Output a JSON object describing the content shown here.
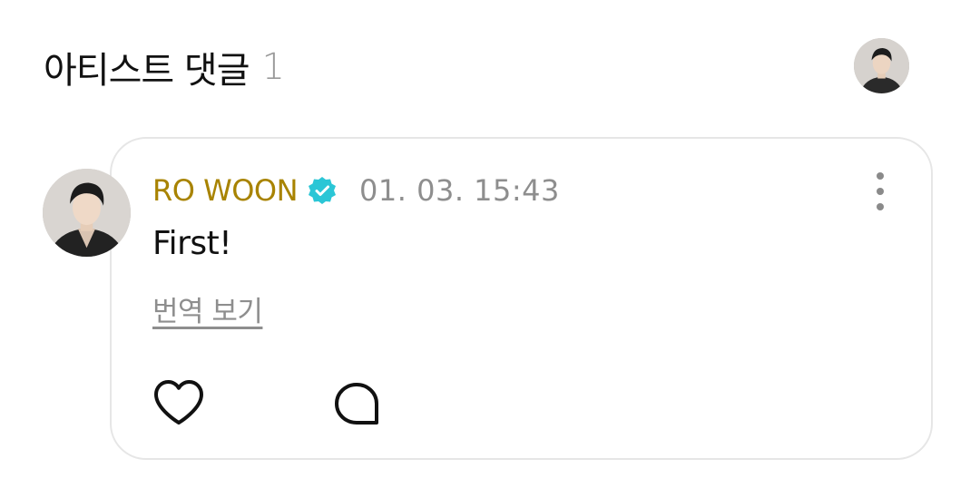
{
  "header": {
    "title": "아티스트 댓글",
    "count": "1",
    "profile_icon": "user-avatar"
  },
  "comment": {
    "author": "RO WOON",
    "verified_icon": "verified-badge-icon",
    "timestamp": "01. 03. 15:43",
    "text": "First!",
    "translate_label": "번역 보기",
    "actions": {
      "like_icon": "heart-icon",
      "reply_icon": "comment-bubble-icon",
      "more_icon": "more-vertical-icon"
    }
  },
  "colors": {
    "author": "#a88300",
    "verified": "#2bc6d6",
    "muted": "#8e8e8e",
    "card_border": "#e6e6e6"
  }
}
